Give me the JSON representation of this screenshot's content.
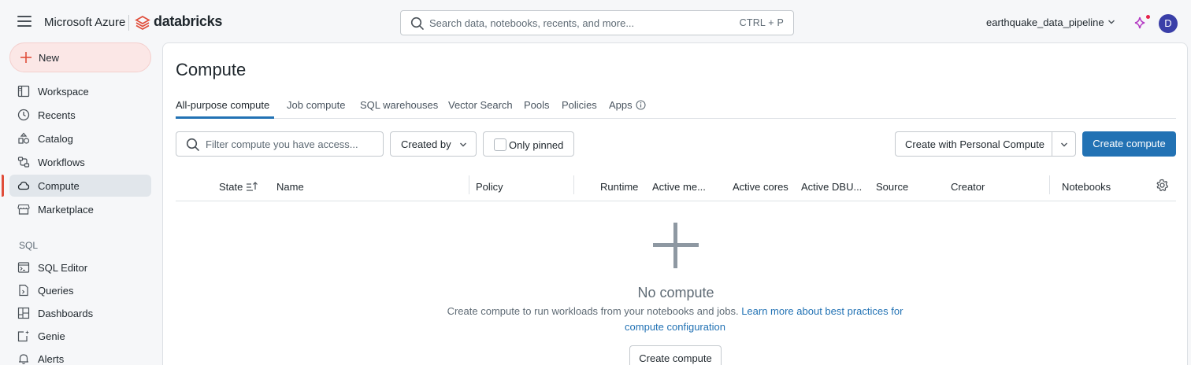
{
  "header": {
    "azure_label": "Microsoft Azure",
    "product_label": "databricks",
    "search_placeholder": "Search data, notebooks, recents, and more...",
    "search_shortcut": "CTRL + P",
    "workspace": "earthquake_data_pipeline",
    "avatar_initial": "D"
  },
  "sidebar": {
    "new_label": "New",
    "items": [
      {
        "label": "Workspace",
        "icon": "workspace-icon"
      },
      {
        "label": "Recents",
        "icon": "clock-icon"
      },
      {
        "label": "Catalog",
        "icon": "catalog-icon"
      },
      {
        "label": "Workflows",
        "icon": "workflows-icon"
      },
      {
        "label": "Compute",
        "icon": "cloud-icon",
        "active": true
      },
      {
        "label": "Marketplace",
        "icon": "store-icon"
      }
    ],
    "sql_section_label": "SQL",
    "sql_items": [
      {
        "label": "SQL Editor",
        "icon": "sql-editor-icon"
      },
      {
        "label": "Queries",
        "icon": "queries-icon"
      },
      {
        "label": "Dashboards",
        "icon": "dashboards-icon"
      },
      {
        "label": "Genie",
        "icon": "genie-icon"
      },
      {
        "label": "Alerts",
        "icon": "bell-icon"
      }
    ]
  },
  "main": {
    "title": "Compute",
    "tabs": [
      {
        "label": "All-purpose compute",
        "active": true
      },
      {
        "label": "Job compute"
      },
      {
        "label": "SQL warehouses"
      },
      {
        "label": "Vector Search"
      },
      {
        "label": "Pools"
      },
      {
        "label": "Policies"
      },
      {
        "label": "Apps"
      }
    ],
    "filter_placeholder": "Filter compute you have access...",
    "created_by_label": "Created by",
    "only_pinned_label": "Only pinned",
    "personal_compute_label": "Create with Personal Compute",
    "create_compute_label": "Create compute",
    "columns": [
      "State",
      "Name",
      "Policy",
      "Runtime",
      "Active me...",
      "Active cores",
      "Active DBU...",
      "Source",
      "Creator",
      "Notebooks"
    ],
    "empty": {
      "title": "No compute",
      "description": "Create compute to run workloads from your notebooks and jobs.",
      "link_line1": "Learn more about best practices for",
      "link_line2": "compute configuration",
      "button_label": "Create compute"
    }
  },
  "colors": {
    "accent_blue": "#2272b4",
    "brand_red": "#e04d3a",
    "active_bg": "#e1e6eb"
  }
}
